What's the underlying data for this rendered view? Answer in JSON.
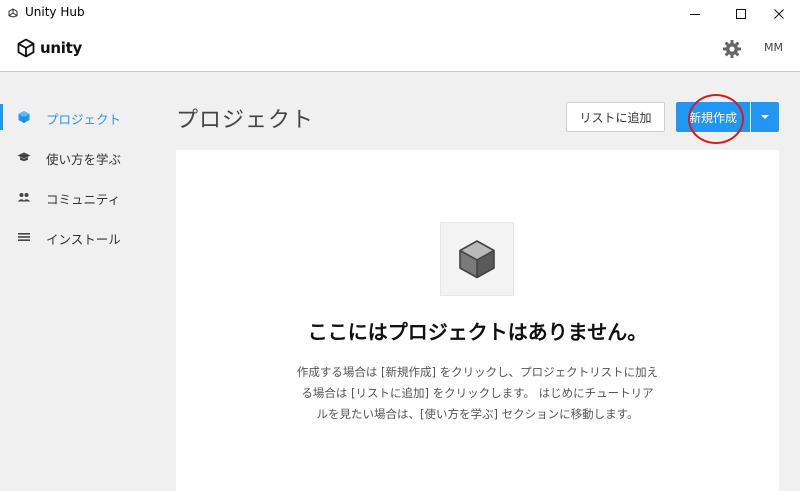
{
  "window": {
    "title": "Unity Hub"
  },
  "header": {
    "logo_text": "unity",
    "user_initials": "MM"
  },
  "sidebar": {
    "items": [
      {
        "label": "プロジェクト",
        "icon": "cube-icon",
        "active": true
      },
      {
        "label": "使い方を学ぶ",
        "icon": "graduation-cap-icon",
        "active": false
      },
      {
        "label": "コミュニティ",
        "icon": "people-icon",
        "active": false
      },
      {
        "label": "インストール",
        "icon": "list-icon",
        "active": false
      }
    ]
  },
  "main": {
    "title": "プロジェクト",
    "add_to_list_label": "リストに追加",
    "new_label": "新規作成",
    "empty_title": "ここにはプロジェクトはありません。",
    "empty_desc": "作成する場合は [新規作成] をクリックし、プロジェクトリストに加える場合は [リストに追加] をクリックします。 はじめにチュートリアルを見たい場合は、[使い方を学ぶ] セクションに移動します。"
  },
  "colors": {
    "accent": "#2196f3",
    "annotation": "#d81b1b",
    "background": "#f0f0f0"
  }
}
